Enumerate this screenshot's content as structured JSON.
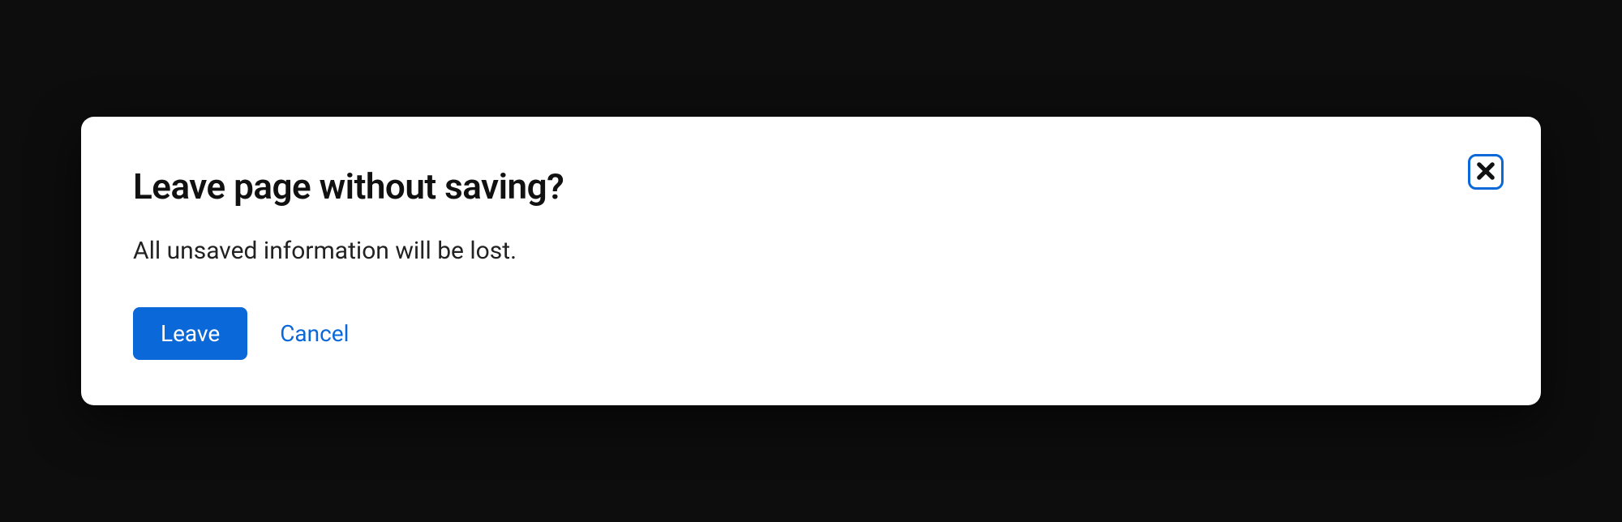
{
  "dialog": {
    "title": "Leave page without saving?",
    "body": "All unsaved information will be lost.",
    "primary_action": "Leave",
    "secondary_action": "Cancel"
  }
}
